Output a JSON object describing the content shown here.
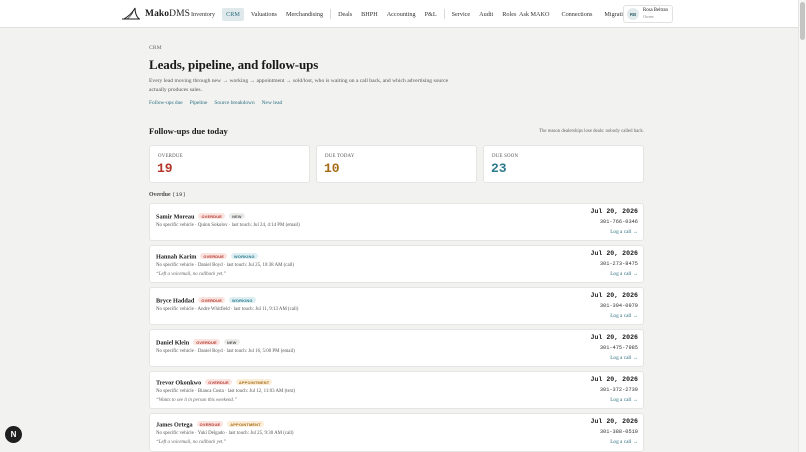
{
  "brand": {
    "name_bold": "Mako",
    "name_rest": "DMS"
  },
  "nav": {
    "items": [
      "Inventory",
      "CRM",
      "Valuations",
      "Merchandising",
      "Deals",
      "BHPH",
      "Accounting",
      "P&L",
      "Service",
      "Audit",
      "Roles"
    ],
    "active": "CRM",
    "right_items": [
      "Ask MAKO",
      "Connections",
      "Migration"
    ]
  },
  "user": {
    "initials": "RB",
    "name": "Rosa Beltran",
    "role": "Owner"
  },
  "header": {
    "eyebrow": "CRM",
    "title": "Leads, pipeline, and follow-ups",
    "description": "Every lead moving through new → working → appointment → sold/lost, who is waiting on a call back, and which advertising source actually produces sales.",
    "subnav": [
      "Follow-ups due",
      "Pipeline",
      "Source breakdown",
      "New lead"
    ]
  },
  "followups": {
    "title": "Follow-ups due today",
    "note": "The reason dealerships lose deals: nobody called back."
  },
  "stats": [
    {
      "label": "OVERDUE",
      "value": "19",
      "color": "#b3352a"
    },
    {
      "label": "DUE TODAY",
      "value": "10",
      "color": "#a56a14"
    },
    {
      "label": "DUE SOON",
      "value": "23",
      "color": "#2c7a8d"
    }
  ],
  "list": {
    "heading": "Overdue",
    "count": "(19)"
  },
  "leads": [
    {
      "name": "Samir Moreau",
      "badges": [
        {
          "text": "OVERDUE",
          "kind": "overdue"
        },
        {
          "text": "NEW",
          "kind": "new"
        }
      ],
      "meta": "No specific vehicle · Quinn Sokolov · last touch: Jul 24, 4:14 PM (email)",
      "note": "",
      "date": "Jul 20, 2026",
      "phone": "301-766-0346",
      "action": "Log a call →"
    },
    {
      "name": "Hannah Karim",
      "badges": [
        {
          "text": "OVERDUE",
          "kind": "overdue"
        },
        {
          "text": "WORKING",
          "kind": "working"
        }
      ],
      "meta": "No specific vehicle · Daniel Boyd · last touch: Jul 25, 10:38 AM (call)",
      "note": "“Left a voicemail, no callback yet.”",
      "date": "Jul 20, 2026",
      "phone": "301-273-8475",
      "action": "Log a call →"
    },
    {
      "name": "Bryce Haddad",
      "badges": [
        {
          "text": "OVERDUE",
          "kind": "overdue"
        },
        {
          "text": "WORKING",
          "kind": "working"
        }
      ],
      "meta": "No specific vehicle · Andre Whitfield · last touch: Jul 11, 9:13 AM (call)",
      "note": "",
      "date": "Jul 20, 2026",
      "phone": "301-394-0979",
      "action": "Log a call →"
    },
    {
      "name": "Daniel Klein",
      "badges": [
        {
          "text": "OVERDUE",
          "kind": "overdue"
        },
        {
          "text": "NEW",
          "kind": "new"
        }
      ],
      "meta": "No specific vehicle · Daniel Boyd · last touch: Jul 16, 5:00 PM (email)",
      "note": "",
      "date": "Jul 20, 2026",
      "phone": "301-475-7985",
      "action": "Log a call →"
    },
    {
      "name": "Trevor Okonkwo",
      "badges": [
        {
          "text": "OVERDUE",
          "kind": "overdue"
        },
        {
          "text": "APPOINTMENT",
          "kind": "appointment"
        }
      ],
      "meta": "No specific vehicle · Bianca Costa · last touch: Jul 12, 11:03 AM (text)",
      "note": "“Wants to see it in person this weekend.”",
      "date": "Jul 20, 2026",
      "phone": "301-372-2739",
      "action": "Log a call →"
    },
    {
      "name": "James Ortega",
      "badges": [
        {
          "text": "OVERDUE",
          "kind": "overdue"
        },
        {
          "text": "APPOINTMENT",
          "kind": "appointment"
        }
      ],
      "meta": "No specific vehicle · Yuki Delgado · last touch: Jul 25, 9:30 AM (call)",
      "note": "“Left a voicemail, no callback yet.”",
      "date": "Jul 20, 2026",
      "phone": "301-388-0510",
      "action": "Log a call →"
    }
  ],
  "fab": {
    "label": "N"
  }
}
